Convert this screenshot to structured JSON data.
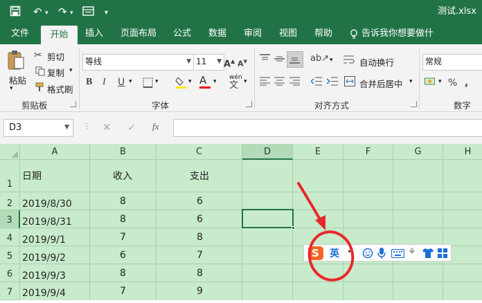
{
  "titlebar": {
    "filename": "测试.xlsx"
  },
  "tabs": [
    {
      "label": "文件"
    },
    {
      "label": "开始",
      "active": true
    },
    {
      "label": "插入"
    },
    {
      "label": "页面布局"
    },
    {
      "label": "公式"
    },
    {
      "label": "数据"
    },
    {
      "label": "审阅"
    },
    {
      "label": "视图"
    },
    {
      "label": "帮助"
    }
  ],
  "tell_me": "告诉我你想要做什么",
  "ribbon": {
    "paste": "粘贴",
    "cut": "剪切",
    "copy": "复制",
    "format_painter": "格式刷",
    "clipboard_group": "剪贴板",
    "font_name": "等线",
    "font_size": "11",
    "bold": "B",
    "italic": "I",
    "underline": "U",
    "phonetic": "wén",
    "font_group": "字体",
    "wrap_text": "自动换行",
    "merge_center": "合并后居中",
    "align_group": "对齐方式",
    "number_format": "常规",
    "number_group": "数字",
    "percent": "%"
  },
  "formula_bar": {
    "name_box": "D3",
    "fx": "fx",
    "formula": ""
  },
  "columns": [
    "A",
    "B",
    "C",
    "D",
    "E",
    "F",
    "G",
    "H"
  ],
  "rows": [
    "1",
    "2",
    "3",
    "4",
    "5",
    "6",
    "7"
  ],
  "cells": {
    "header": {
      "a": "日期",
      "b": "收入",
      "c": "支出"
    },
    "data": [
      {
        "a": "2019/8/30",
        "b": "8",
        "c": "6"
      },
      {
        "a": "2019/8/31",
        "b": "8",
        "c": "6"
      },
      {
        "a": "2019/9/1",
        "b": "7",
        "c": "8"
      },
      {
        "a": "2019/9/2",
        "b": "6",
        "c": "7"
      },
      {
        "a": "2019/9/3",
        "b": "8",
        "c": "8"
      },
      {
        "a": "2019/9/4",
        "b": "7",
        "c": "9"
      }
    ]
  },
  "ime": {
    "mode": "英"
  },
  "colors": {
    "excel_green": "#217346",
    "sheet_bg": "#c8ebcb",
    "annotation_red": "#e8282a",
    "sogou_orange": "#f26522",
    "ime_blue": "#1a6fd6"
  },
  "icons": [
    "save-icon",
    "undo-icon",
    "redo-icon",
    "form-icon",
    "customize-qat-icon",
    "lightbulb-icon",
    "smile-icon",
    "microphone-icon",
    "keyboard-icon",
    "shirt-icon",
    "grid-icon",
    "fx-icon",
    "red-arrow-annotation",
    "red-circle-annotation"
  ]
}
